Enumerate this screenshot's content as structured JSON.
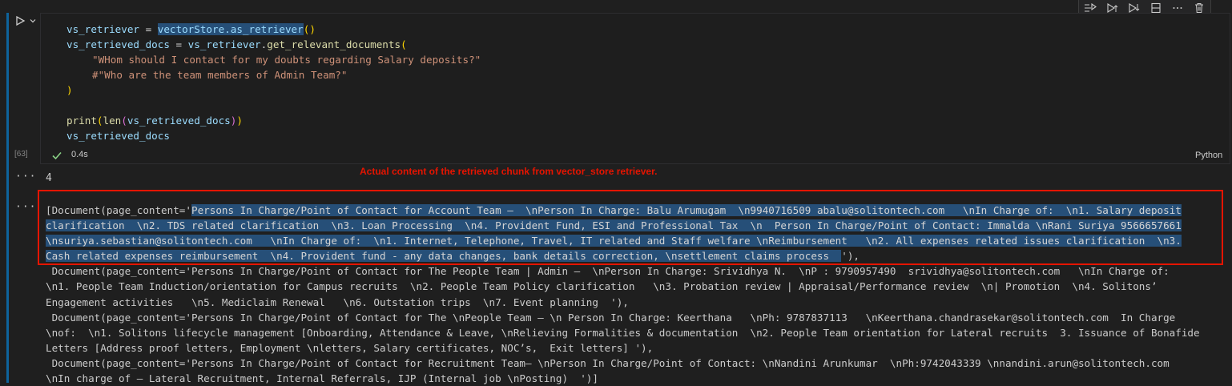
{
  "cell": {
    "execution_count": "[63]",
    "exec_time": "0.4s",
    "language": "Python",
    "code": {
      "l1_var": "vs_retriever",
      "l1_eq": " = ",
      "l1_call": "vectorStore.as_retriever",
      "l1_paren": "()",
      "l2_var": "vs_retrieved_docs",
      "l2_eq": " = ",
      "l2_obj": "vs_retriever",
      "l2_dot": ".",
      "l2_fn": "get_relevant_documents",
      "l2_paren": "(",
      "l3_str": "\"WHom should I contact for my doubts regarding Salary deposits?\"",
      "l4_comment": "#\"Who are the team members of Admin Team?\"",
      "l5_paren": ")",
      "l7_fn": "print",
      "l7_p1": "(",
      "l7_len": "len",
      "l7_p2": "(",
      "l7_var": "vs_retrieved_docs",
      "l7_p3": ")",
      "l7_p4": ")",
      "l8_var": "vs_retrieved_docs"
    }
  },
  "output": {
    "count": "4",
    "annotation": "Actual content of the retrieved chunk from vector_store retriever.",
    "lines": [
      {
        "pre": "[Document(page_content='",
        "sel": "Persons In Charge/Point of Contact for Account Team –  \\nPerson In Charge: Balu Arumugam  \\n9940716509 abalu@solitontech.com   \\nIn Charge of:  \\n1. Salary deposit",
        "post": ""
      },
      {
        "pre": "",
        "sel": "clarification  \\n2. TDS related clarification  \\n3. Loan Processing  \\n4. Provident Fund, ESI and Professional Tax  \\n  Person In Charge/Point of Contact: Immalda \\nRani Suriya 9566657661",
        "post": ""
      },
      {
        "pre": "",
        "sel": "\\nsuriya.sebastian@solitontech.com   \\nIn Charge of:  \\n1. Internet, Telephone, Travel, IT related and Staff welfare \\nReimbursement   \\n2. All expenses related issues clarification  \\n3.",
        "post": ""
      },
      {
        "pre": "",
        "sel": "Cash related expenses reimbursement  \\n4. Provident fund - any data changes, bank details correction, \\nsettlement claims process  ",
        "post": "'),"
      },
      {
        "pre": "",
        "sel": "",
        "post": " Document(page_content='Persons In Charge/Point of Contact for The People Team | Admin –  \\nPerson In Charge: Srividhya N.  \\nP : 9790957490  srividhya@solitontech.com   \\nIn Charge of:"
      },
      {
        "pre": "",
        "sel": "",
        "post": "\\n1. People Team Induction/orientation for Campus recruits  \\n2. People Team Policy clarification   \\n3. Probation review | Appraisal/Performance review  \\n| Promotion  \\n4. Solitons’"
      },
      {
        "pre": "",
        "sel": "",
        "post": "Engagement activities   \\n5. Mediclaim Renewal   \\n6. Outstation trips  \\n7. Event planning  '),"
      },
      {
        "pre": "",
        "sel": "",
        "post": " Document(page_content='Persons In Charge/Point of Contact for The \\nPeople Team – \\n Person In Charge: Keerthana   \\nPh: 9787837113   \\nKeerthana.chandrasekar@solitontech.com  In Charge"
      },
      {
        "pre": "",
        "sel": "",
        "post": "\\nof:  \\n1. Solitons lifecycle management [Onboarding, Attendance & Leave, \\nRelieving Formalities & documentation  \\n2. People Team orientation for Lateral recruits  3. Issuance of Bonafide"
      },
      {
        "pre": "",
        "sel": "",
        "post": "Letters [Address proof letters, Employment \\nletters, Salary certificates, NOC’s,  Exit letters] '),"
      },
      {
        "pre": "",
        "sel": "",
        "post": " Document(page_content='Persons In Charge/Point of Contact for Recruitment Team– \\nPerson In Charge/Point of Contact: \\nNandini Arunkumar  \\nPh:9742043339 \\nnandini.arun@solitontech.com"
      },
      {
        "pre": "",
        "sel": "",
        "post": "\\nIn charge of – Lateral Recruitment, Internal Referrals, IJP (Internal job \\nPosting)  ')]"
      }
    ]
  },
  "icons": [
    "run-icon",
    "chevron-down-icon",
    "run-by-line-icon",
    "execute-above-icon",
    "execute-below-icon",
    "split-cell-icon",
    "more-actions-icon",
    "delete-icon",
    "check-icon"
  ]
}
